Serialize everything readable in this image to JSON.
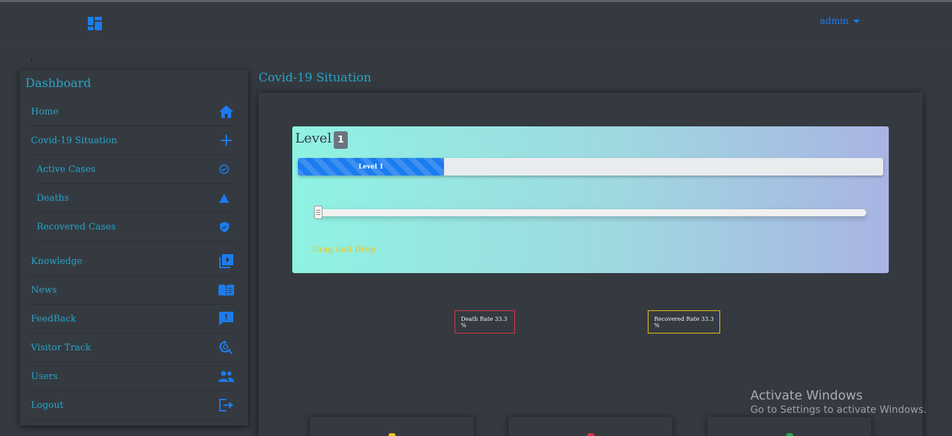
{
  "header": {
    "user_label": "admin"
  },
  "sidebar": {
    "title": "Dashboard",
    "items": [
      {
        "label": "Home",
        "icon": "home-icon"
      },
      {
        "label": "Covid-19 Situation",
        "icon": "plus-icon"
      },
      {
        "label": "Active Cases",
        "icon": "check-circle-icon"
      },
      {
        "label": "Deaths",
        "icon": "warning-triangle-icon"
      },
      {
        "label": "Recovered Cases",
        "icon": "shield-check-icon"
      },
      {
        "label": "Knowledge",
        "icon": "video-library-icon"
      },
      {
        "label": "News",
        "icon": "open-book-icon"
      },
      {
        "label": "FeedBack",
        "icon": "feedback-icon"
      },
      {
        "label": "Visitor Track",
        "icon": "search-refresh-icon"
      },
      {
        "label": "Users",
        "icon": "users-icon"
      },
      {
        "label": "Logout",
        "icon": "logout-icon"
      }
    ]
  },
  "main": {
    "page_title": "Covid-19 Situation",
    "level": {
      "label": "Level",
      "badge": "1",
      "progress_text": "Level 1",
      "progress_fraction": 0.25,
      "slider_value_fraction": 0.0,
      "drag_label": "Drag and Drop"
    },
    "rates": {
      "death": "Death Rate 33.3 %",
      "recovered": "Recovered Rate 33.3 %"
    },
    "stat_cards": [
      {
        "accent": "#f0c419"
      },
      {
        "accent": "#dc3545"
      },
      {
        "accent": "#28a745"
      }
    ]
  },
  "watermark": {
    "line1": "Activate Windows",
    "line2": "Go to Settings to activate Windows."
  },
  "colors": {
    "background": "#343a40",
    "accent_text": "#2aa3c9",
    "primary": "#1b7cf0",
    "danger": "#dc3545",
    "warning": "#f0c419"
  }
}
